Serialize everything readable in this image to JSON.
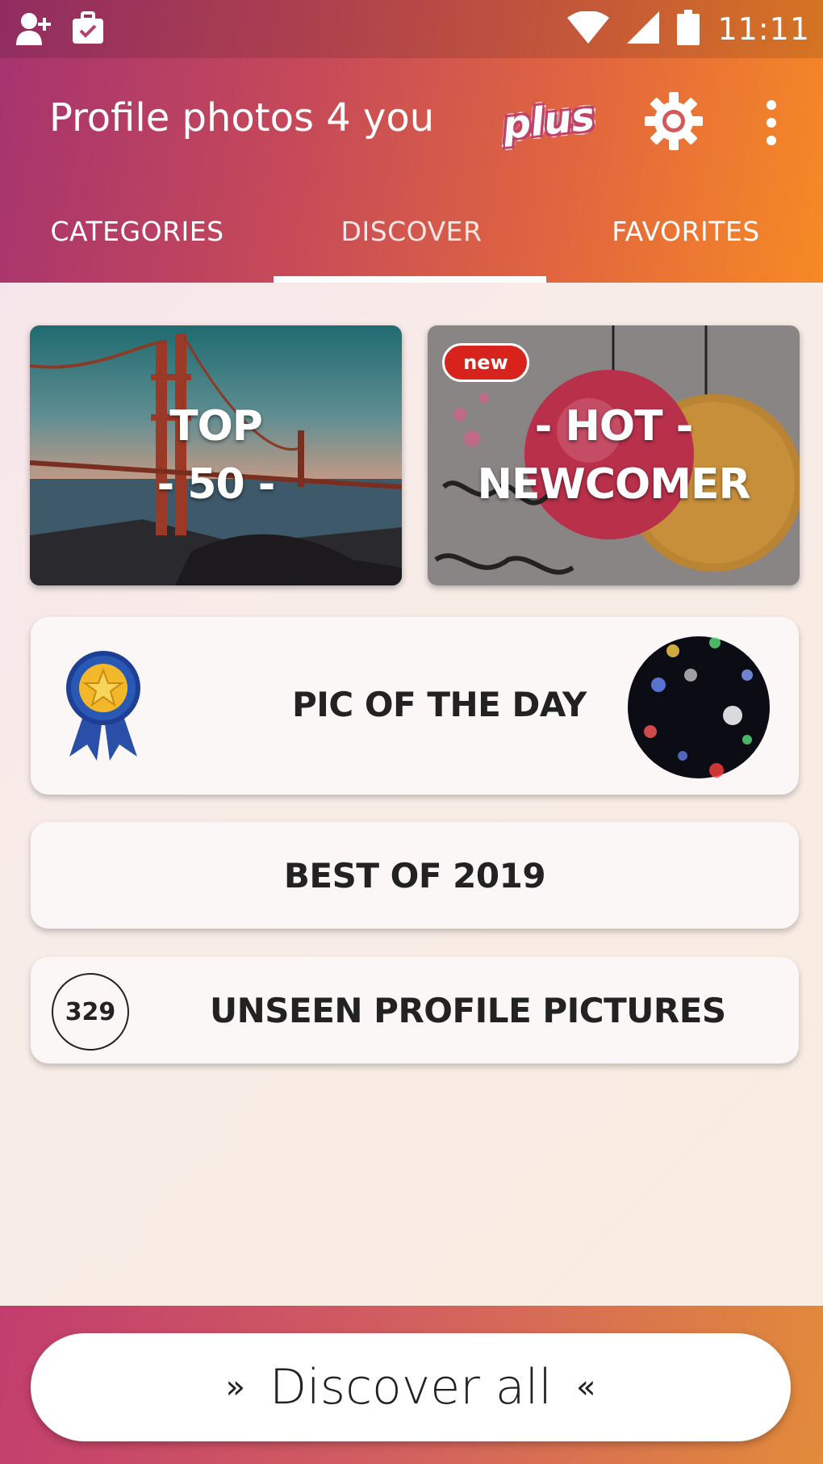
{
  "status_bar": {
    "time": "11:11",
    "left_icons": [
      "add-contact-icon",
      "briefcase-check-icon"
    ],
    "right_icons": [
      "wifi-icon",
      "signal-icon",
      "battery-icon"
    ]
  },
  "app_bar": {
    "title": "Profile photos 4 you",
    "plus_label": "plus",
    "settings_icon": "gear-icon",
    "menu_icon": "more-vertical-icon"
  },
  "tabs": [
    {
      "label": "CATEGORIES",
      "active": false
    },
    {
      "label": "DISCOVER",
      "active": true
    },
    {
      "label": "FAVORITES",
      "active": false
    }
  ],
  "tiles": {
    "top50": {
      "line1": "TOP",
      "line2": "- 50 -"
    },
    "hot": {
      "badge": "new",
      "line1": "- HOT -",
      "line2": "NEWCOMER"
    }
  },
  "cards": {
    "pic_of_the_day": {
      "label": "PIC OF THE DAY",
      "icon": "award-ribbon-icon"
    },
    "best_of": {
      "label": "BEST OF 2019"
    },
    "unseen": {
      "count": "329",
      "label": "UNSEEN PROFILE PICTURES"
    }
  },
  "bottom": {
    "discover_all": "Discover all",
    "left_quote": "»",
    "right_quote": "«"
  },
  "colors": {
    "header_start": "#a5336f",
    "header_end": "#f68a24",
    "badge_red": "#d8221c"
  }
}
